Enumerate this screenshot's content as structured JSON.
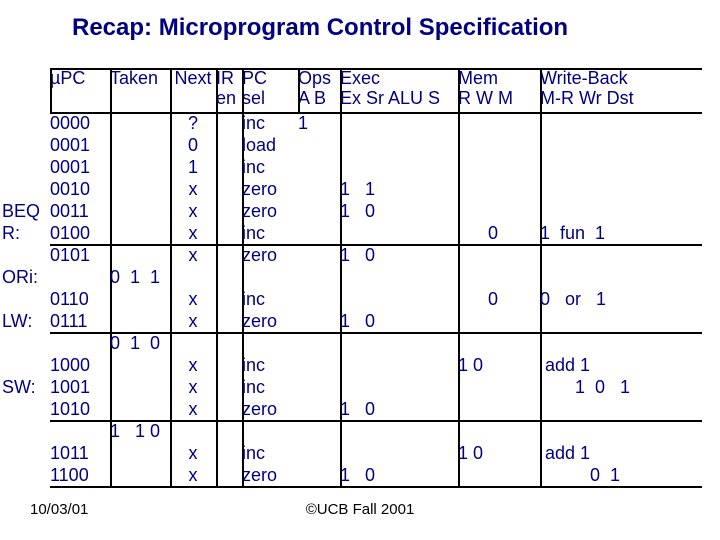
{
  "title": "Recap: Microprogram Control Specification",
  "footer": {
    "left": "10/03/01",
    "center": "©UCB Fall 2001"
  },
  "headers": {
    "upc": {
      "l1": "µPC",
      "l2": ""
    },
    "taken": {
      "l1": "Taken",
      "l2": ""
    },
    "next": {
      "l1": "Next",
      "l2": ""
    },
    "ir": {
      "l1": "IR",
      "l2": "en"
    },
    "pc": {
      "l1": "PC",
      "l2": "sel"
    },
    "ops": {
      "l1": "Ops",
      "l2": "A B"
    },
    "exec": {
      "l1": "Exec",
      "l2": "Ex Sr ALU S"
    },
    "mem": {
      "l1": "Mem",
      "l2": "R W M"
    },
    "wb": {
      "l1": "Write-Back",
      "l2": "M-R Wr Dst"
    }
  },
  "chart_data": {
    "type": "table",
    "rows": [
      {
        "label": "",
        "upc": "0000",
        "taken": "",
        "next": "?",
        "ir": "",
        "pc": "inc",
        "ops": "1",
        "exec": "",
        "mem": "",
        "wb": ""
      },
      {
        "label": "",
        "upc": "0001",
        "taken": "",
        "next": "0",
        "ir": "",
        "pc": "load",
        "ops": "",
        "exec": "",
        "mem": "",
        "wb": ""
      },
      {
        "label": "",
        "upc": "0001",
        "taken": "",
        "next": "1",
        "ir": "",
        "pc": "inc",
        "ops": "",
        "exec": "",
        "mem": "",
        "wb": ""
      },
      {
        "label": "",
        "upc": "0010",
        "taken": "",
        "next": "x",
        "ir": "",
        "pc": "zero",
        "ops": "",
        "exec": "1   1",
        "mem": "",
        "wb": ""
      },
      {
        "label": "BEQ",
        "upc": "0011",
        "taken": "",
        "next": "x",
        "ir": "",
        "pc": "zero",
        "ops": "",
        "exec": "1   0",
        "mem": "",
        "wb": ""
      },
      {
        "label": "R:",
        "upc": "0100",
        "taken": "",
        "next": "x",
        "ir": "",
        "pc": "inc",
        "ops": "",
        "exec": "",
        "mem": "      0",
        "wb": "1  fun  1"
      },
      {
        "label": "",
        "upc": "0101",
        "taken": "",
        "next": "x",
        "ir": "",
        "pc": "zero",
        "ops": "",
        "exec": "1   0",
        "mem": "",
        "wb": ""
      },
      {
        "label": "ORi:",
        "upc": "",
        "taken": "0  1  1",
        "next": "",
        "ir": "",
        "pc": "",
        "ops": "",
        "exec": "",
        "mem": "",
        "wb": ""
      },
      {
        "label": "",
        "upc": "0110",
        "taken": "",
        "next": "x",
        "ir": "",
        "pc": "inc",
        "ops": "",
        "exec": "",
        "mem": "      0",
        "wb": "0   or   1"
      },
      {
        "label": "LW:",
        "upc": "0111",
        "taken": "",
        "next": "x",
        "ir": "",
        "pc": "zero",
        "ops": "",
        "exec": "1   0",
        "mem": "",
        "wb": ""
      },
      {
        "label": "",
        "upc": "",
        "taken": "0  1  0",
        "next": "",
        "ir": "",
        "pc": "",
        "ops": "",
        "exec": "",
        "mem": "",
        "wb": ""
      },
      {
        "label": "",
        "upc": "1000",
        "taken": "",
        "next": "x",
        "ir": "",
        "pc": "inc",
        "ops": "",
        "exec": "",
        "mem": "1 0",
        "wb": " add 1"
      },
      {
        "label": "SW:",
        "upc": "1001",
        "taken": "",
        "next": "x",
        "ir": "",
        "pc": "inc",
        "ops": "",
        "exec": "",
        "mem": "",
        "wb": "       1  0   1"
      },
      {
        "label": "",
        "upc": "1010",
        "taken": "",
        "next": "x",
        "ir": "",
        "pc": "zero",
        "ops": "",
        "exec": "1   0",
        "mem": "",
        "wb": ""
      },
      {
        "label": "",
        "upc": "",
        "taken": "1   1 0",
        "next": "",
        "ir": "",
        "pc": "",
        "ops": "",
        "exec": "",
        "mem": "",
        "wb": ""
      },
      {
        "label": "",
        "upc": "1011",
        "taken": "",
        "next": "x",
        "ir": "",
        "pc": "inc",
        "ops": "",
        "exec": "",
        "mem": "1 0",
        "wb": " add 1"
      },
      {
        "label": "",
        "upc": "1100",
        "taken": "",
        "next": "x",
        "ir": "",
        "pc": "zero",
        "ops": "",
        "exec": "1   0",
        "mem": "",
        "wb": "          0  1"
      }
    ]
  }
}
